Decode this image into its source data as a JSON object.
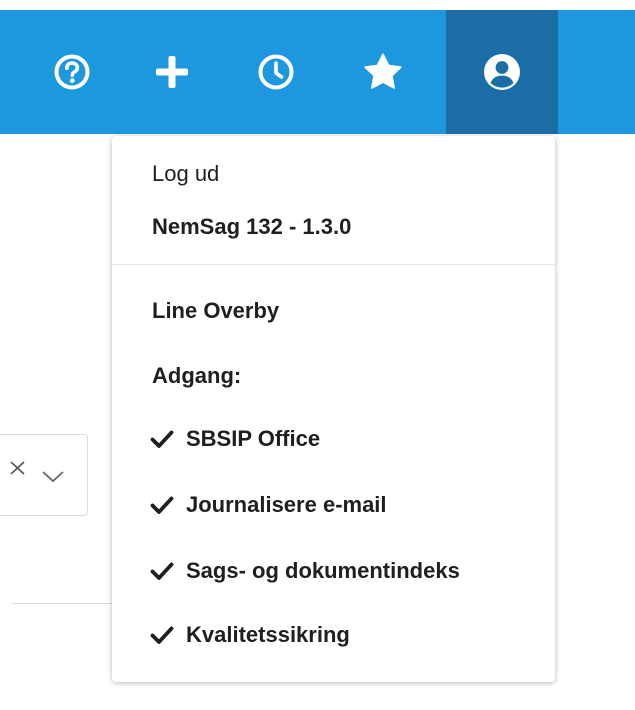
{
  "topbar": {
    "accent_color": "#1d98df",
    "active_color": "#1b6da6",
    "buttons": [
      {
        "icon": "help-circle-icon"
      },
      {
        "icon": "plus-icon"
      },
      {
        "icon": "clock-icon"
      },
      {
        "icon": "star-icon"
      },
      {
        "icon": "user-circle-icon",
        "active": true
      }
    ]
  },
  "user_menu": {
    "logout_label": "Log ud",
    "version": "NemSag 132 - 1.3.0",
    "user_name": "Line Overby",
    "access_heading": "Adgang:",
    "permissions": [
      "SBSIP Office",
      "Journalisere e-mail",
      "Sags- og dokumentindeks",
      "Kvalitetssikring"
    ],
    "permission_icon": "checkmark-icon"
  },
  "background": {
    "select_icons": [
      "clear-x-icon",
      "chevron-down-icon"
    ]
  }
}
